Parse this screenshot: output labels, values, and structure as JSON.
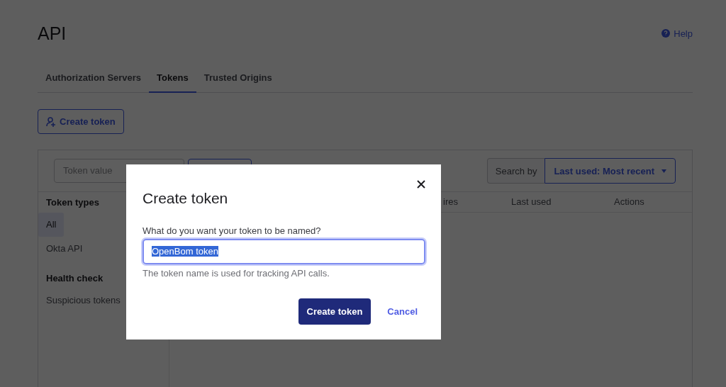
{
  "page": {
    "title": "API",
    "help_link": "Help"
  },
  "tabs": [
    {
      "label": "Authorization Servers",
      "selected": false
    },
    {
      "label": "Tokens",
      "selected": true
    },
    {
      "label": "Trusted Origins",
      "selected": false
    }
  ],
  "create_button": "Create token",
  "filter": {
    "placeholder": "Token value",
    "search_by_label": "Search by",
    "search_by_value": "Last used: Most recent"
  },
  "sidebar": {
    "sections": [
      {
        "heading": "Token types",
        "items": [
          {
            "label": "All",
            "selected": true
          },
          {
            "label": "Okta API",
            "selected": false
          }
        ]
      },
      {
        "heading": "Health check",
        "items": [
          {
            "label": "Suspicious tokens",
            "selected": false
          }
        ]
      }
    ]
  },
  "table": {
    "columns": [
      "ires",
      "Last used",
      "Actions"
    ]
  },
  "dialog": {
    "title": "Create token",
    "field_label": "What do you want your token to be named?",
    "value": "OpenBom token",
    "value_selected": true,
    "hint": "The token name is used for tracking API calls.",
    "buttons": [
      {
        "label": "Create token",
        "kind": "primary"
      },
      {
        "label": "Cancel",
        "kind": "link"
      }
    ]
  }
}
